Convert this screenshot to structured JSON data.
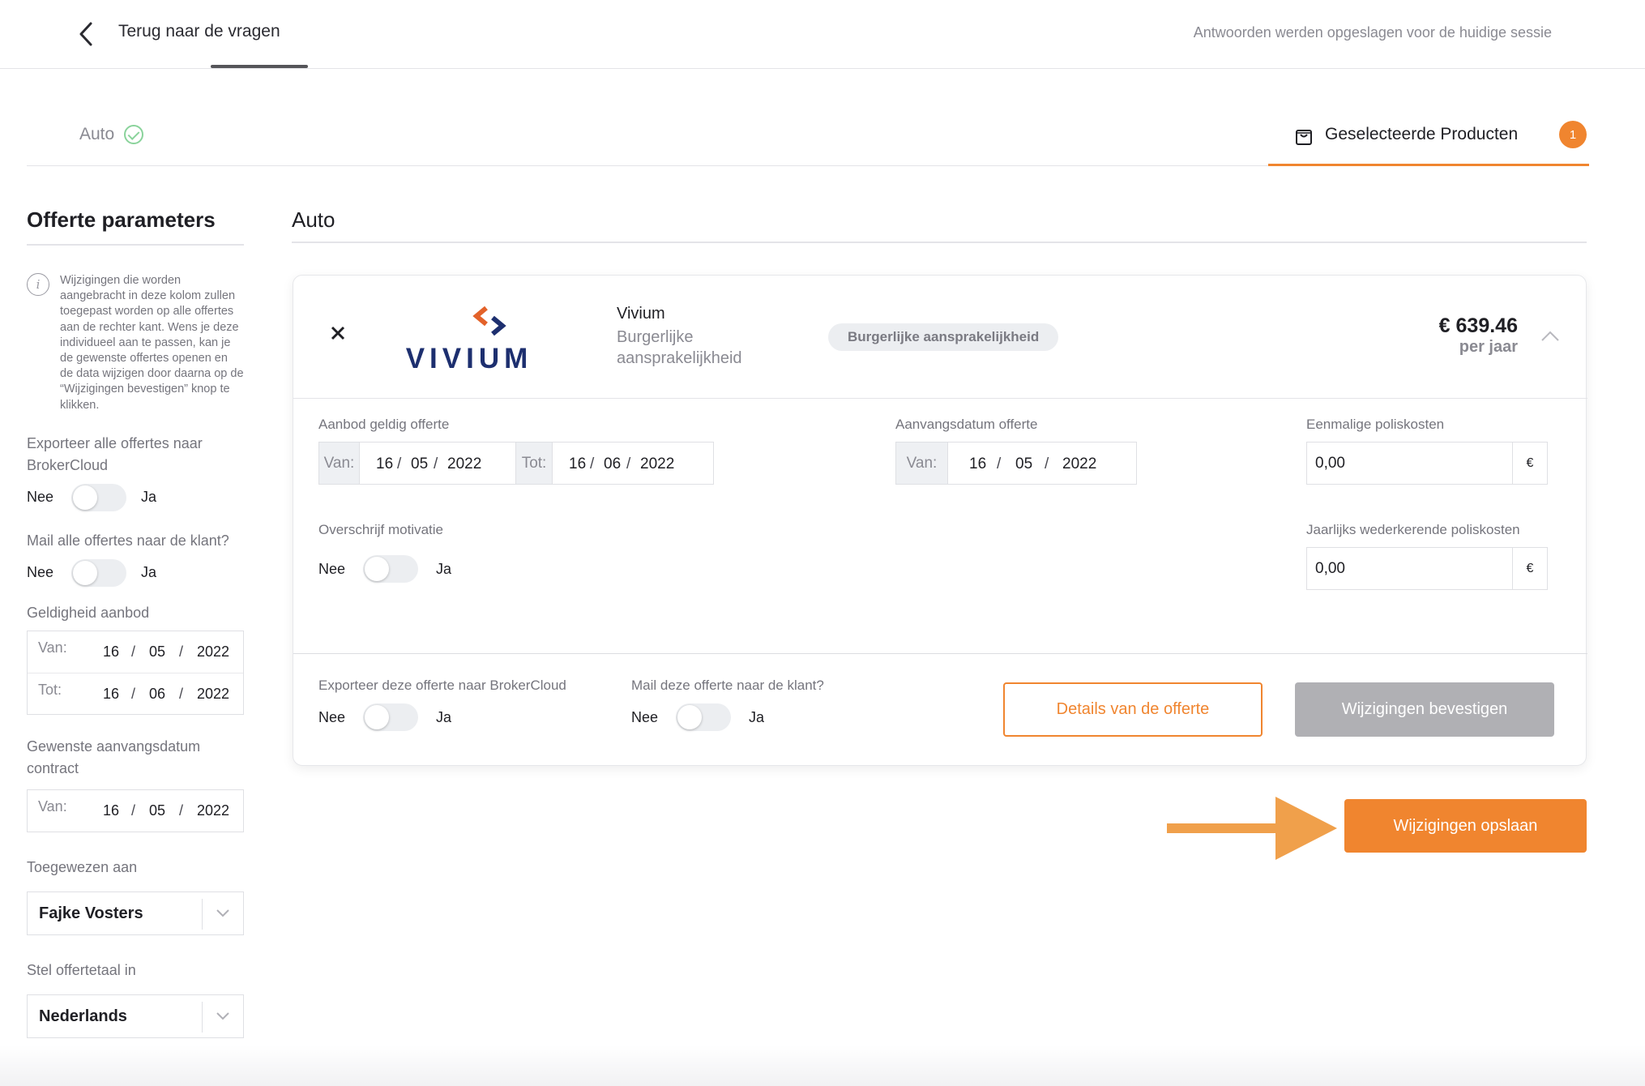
{
  "header": {
    "back_label": "Terug naar de vragen",
    "session_note": "Antwoorden werden opgeslagen voor de huidige sessie"
  },
  "tabs": {
    "auto_label": "Auto",
    "selected_label": "Geselecteerde Producten",
    "selected_count": "1"
  },
  "sidebar": {
    "title": "Offerte parameters",
    "info": "Wijzigingen die worden aangebracht in deze kolom zullen toegepast worden op alle offertes aan de rechter kant. Wens je deze individueel aan te passen, kan je de gewenste offertes openen en de data wijzigen door daarna op de “Wijzigingen bevestigen” knop te klikken.",
    "export_label": "Exporteer alle offertes naar BrokerCloud",
    "mail_label": "Mail alle offertes naar de klant?",
    "no": "Nee",
    "yes": "Ja",
    "validity_label": "Geldigheid aanbod",
    "from_prefix": "Van:",
    "to_prefix": "Tot:",
    "validity_from": {
      "day": "16",
      "month": "05",
      "year": "2022"
    },
    "validity_to": {
      "day": "16",
      "month": "06",
      "year": "2022"
    },
    "start_label": "Gewenste aanvangsdatum contract",
    "start_from": {
      "day": "16",
      "month": "05",
      "year": "2022"
    },
    "assigned_label": "Toegewezen aan",
    "assigned_value": "Fajke Vosters",
    "language_label": "Stel offertetaal in",
    "language_value": "Nederlands",
    "separator": "/"
  },
  "main": {
    "title": "Auto"
  },
  "quote": {
    "insurer": "Vivium",
    "product": "Burgerlijke aansprakelijkheid",
    "pill": "Burgerlijke aansprakelijkheid",
    "price": "€ 639.46",
    "price_period": "per jaar",
    "logo_text": "VIVIUM",
    "valid_label": "Aanbod geldig offerte",
    "from_prefix": "Van:",
    "to_prefix": "Tot:",
    "valid_from": {
      "day": "16",
      "month": "05",
      "year": "2022"
    },
    "valid_to": {
      "day": "16",
      "month": "06",
      "year": "2022"
    },
    "start_label": "Aanvangsdatum offerte",
    "start_from": {
      "day": "16",
      "month": "05",
      "year": "2022"
    },
    "once_cost_label": "Eenmalige poliskosten",
    "once_cost_value": "0,00",
    "yearly_cost_label": "Jaarlijks wederkerende poliskosten",
    "yearly_cost_value": "0,00",
    "currency": "€",
    "motivation_label": "Overschrijf motivatie",
    "export_label": "Exporteer deze offerte naar BrokerCloud",
    "mail_label": "Mail deze offerte naar de klant?",
    "no": "Nee",
    "yes": "Ja",
    "separator": "/",
    "details_button": "Details van de offerte",
    "confirm_button": "Wijzigingen bevestigen"
  },
  "save_button": "Wijzigingen opslaan",
  "colors": {
    "accent": "#f0852f",
    "disabled": "#b0b0b4",
    "success": "#8ad39b",
    "logo_orange": "#e3622a",
    "logo_navy": "#1d2f6f"
  }
}
